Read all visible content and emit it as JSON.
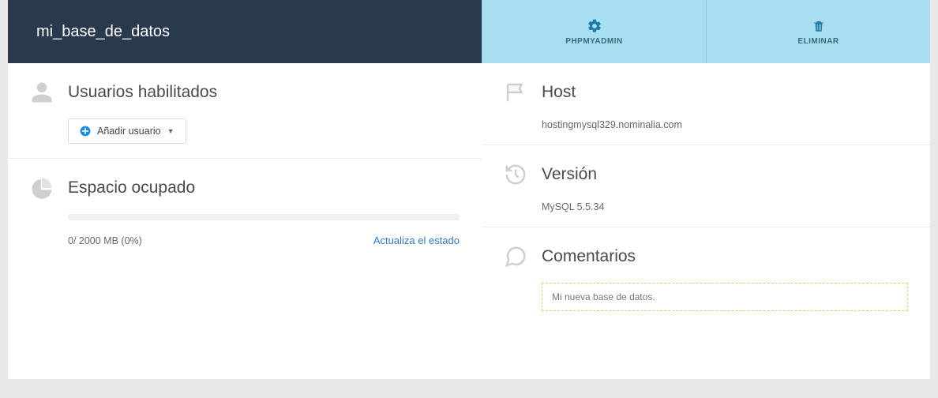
{
  "header": {
    "title": "mi_base_de_datos",
    "actions": {
      "phpmyadmin": "PHPMYADMIN",
      "eliminar": "ELIMINAR"
    }
  },
  "users": {
    "title": "Usuarios habilitados",
    "add_button": "Añadir usuario"
  },
  "space": {
    "title": "Espacio ocupado",
    "usage_text": "0/ 2000 MB (0%)",
    "refresh_link": "Actualiza el estado"
  },
  "host": {
    "title": "Host",
    "value": "hostingmysql329.nominalia.com"
  },
  "version": {
    "title": "Versión",
    "value": "MySQL 5.5.34"
  },
  "comments": {
    "title": "Comentarios",
    "value": "Mi nueva base de datos."
  }
}
